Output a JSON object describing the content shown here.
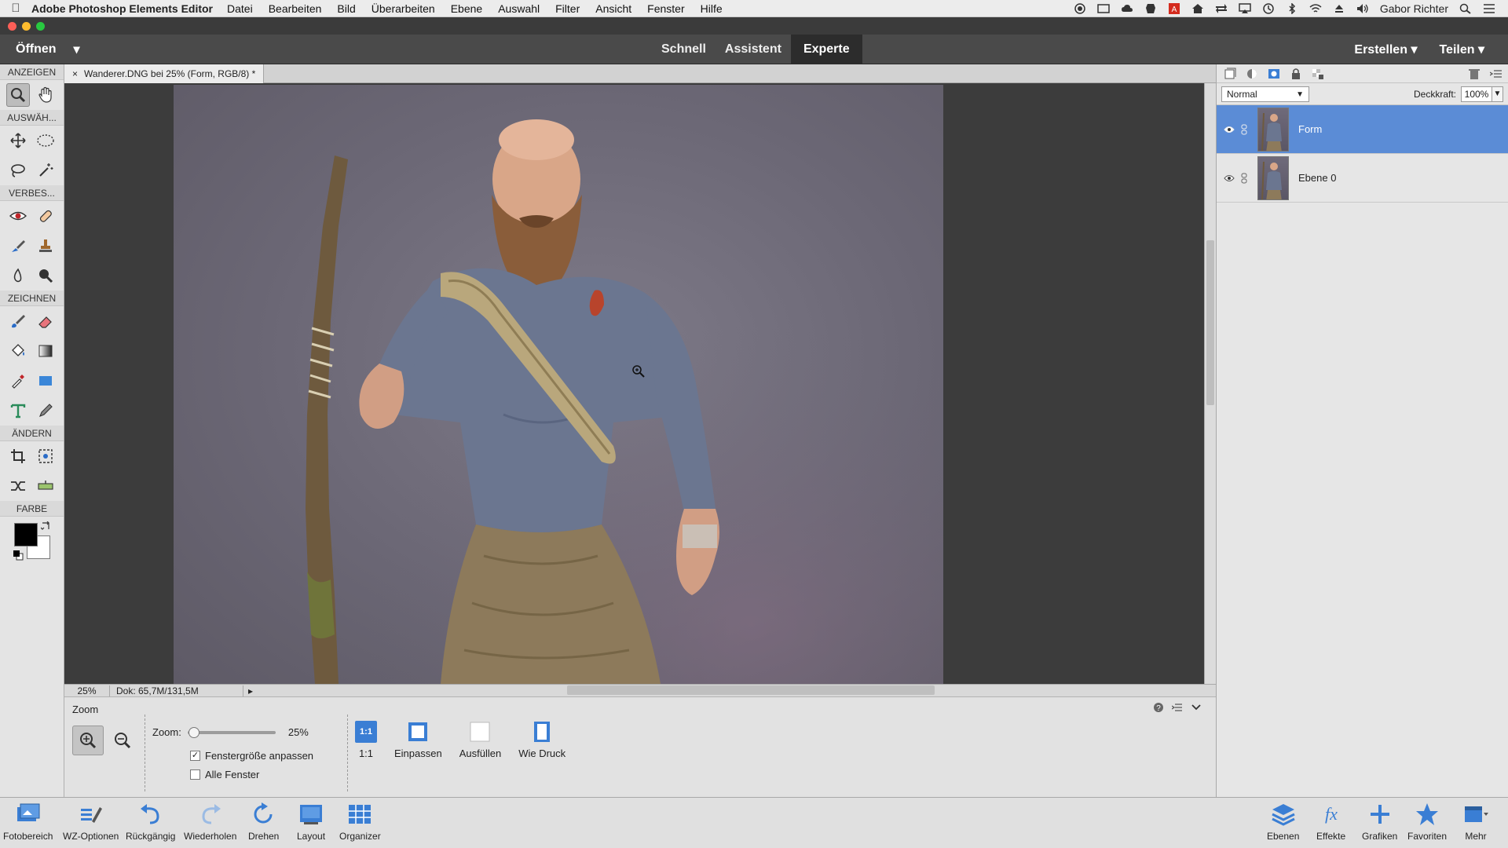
{
  "menubar": {
    "app_name": "Adobe Photoshop Elements Editor",
    "items": [
      "Datei",
      "Bearbeiten",
      "Bild",
      "Überarbeiten",
      "Ebene",
      "Auswahl",
      "Filter",
      "Ansicht",
      "Fenster",
      "Hilfe"
    ],
    "user": "Gabor Richter"
  },
  "modebar": {
    "open_label": "Öffnen",
    "tabs": [
      "Schnell",
      "Assistent",
      "Experte"
    ],
    "active_tab": "Experte",
    "create_label": "Erstellen",
    "share_label": "Teilen"
  },
  "toolbox": {
    "sections": [
      "ANZEIGEN",
      "AUSWÄH...",
      "VERBES...",
      "ZEICHNEN",
      "ÄNDERN",
      "FARBE"
    ]
  },
  "document": {
    "tab_title": "Wanderer.DNG bei 25% (Form, RGB/8) *",
    "close_glyph": "×",
    "status_zoom": "25%",
    "status_doc": "Dok: 65,7M/131,5M"
  },
  "options": {
    "title": "Zoom",
    "zoom_label": "Zoom:",
    "zoom_value": "25%",
    "zoom_fraction": 0.05,
    "check_fit": "Fenstergröße anpassen",
    "check_fit_checked": true,
    "check_all": "Alle Fenster",
    "check_all_checked": false,
    "view_buttons": [
      "1:1",
      "Einpassen",
      "Ausfüllen",
      "Wie Druck"
    ],
    "one_to_one_icon_text": "1:1"
  },
  "layers": {
    "blend_mode": "Normal",
    "opacity_label": "Deckkraft:",
    "opacity_value": "100%",
    "items": [
      {
        "name": "Form",
        "selected": true
      },
      {
        "name": "Ebene 0",
        "selected": false
      }
    ]
  },
  "taskbar": {
    "left": [
      "Fotobereich",
      "WZ-Optionen",
      "Rückgängig",
      "Wiederholen",
      "Drehen",
      "Layout",
      "Organizer"
    ],
    "right": [
      "Ebenen",
      "Effekte",
      "Grafiken",
      "Favoriten",
      "Mehr"
    ]
  },
  "colors": {
    "accent_selected": "#5b8cd6",
    "mode_bar": "#4a4a4a",
    "canvas_bg": "#3c3c3c"
  }
}
